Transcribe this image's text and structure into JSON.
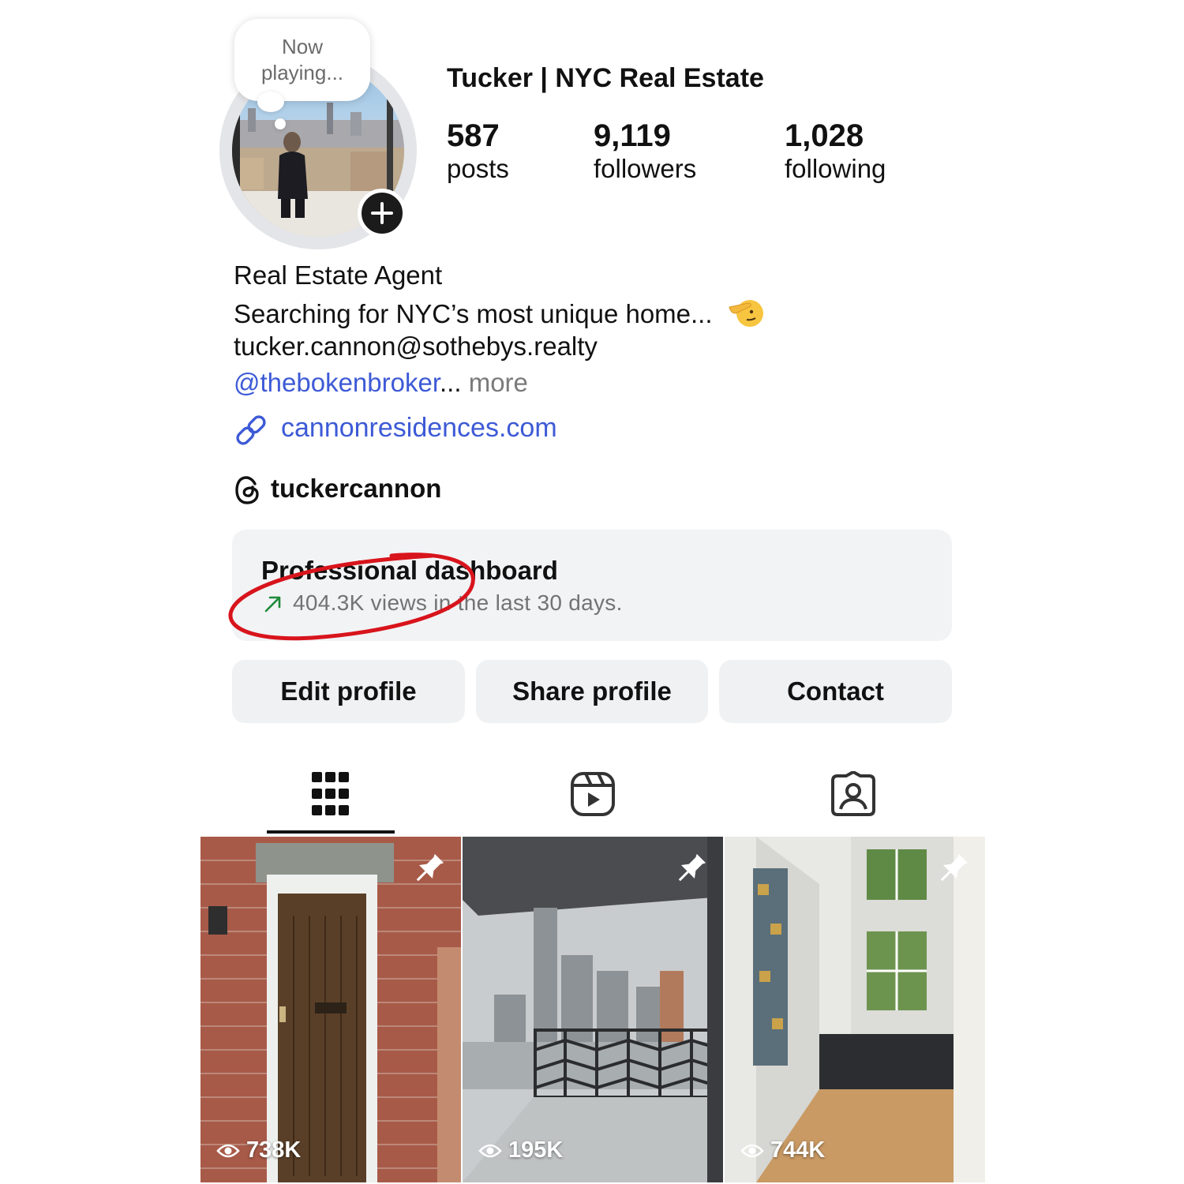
{
  "note": {
    "text": "Now playing..."
  },
  "profile": {
    "username": "Tucker | NYC Real Estate",
    "stats": [
      {
        "value": "587",
        "label": "posts"
      },
      {
        "value": "9,119",
        "label": "followers"
      },
      {
        "value": "1,028",
        "label": "following"
      }
    ]
  },
  "bio": {
    "category": "Real Estate Agent",
    "line1": "Searching for NYC’s most unique home...",
    "emoji_icon": "saluting-face",
    "email": "tucker.cannon@sothebys.realty",
    "mention": "@thebokenbroker",
    "ellipsis": "...",
    "more": " more",
    "link_icon": "link-icon",
    "website": "cannonresidences.com",
    "threads_icon": "threads-icon",
    "threads_handle": "tuckercannon"
  },
  "dashboard": {
    "title": "Professional dashboard",
    "subtitle": "404.3K views in the last 30 days.",
    "trend_icon": "arrow-up-right-icon",
    "trend_color": "#1f8a3b",
    "annotation_color": "#d8141c"
  },
  "buttons": {
    "edit": "Edit profile",
    "share": "Share profile",
    "contact": "Contact"
  },
  "tabs": [
    {
      "icon": "grid-icon",
      "active": true
    },
    {
      "icon": "reels-icon",
      "active": false
    },
    {
      "icon": "tagged-icon",
      "active": false
    }
  ],
  "posts": [
    {
      "views": "738K",
      "pinned": true,
      "subject": "wooden-door-brick-wall"
    },
    {
      "views": "195K",
      "pinned": true,
      "subject": "balcony-skyline-view"
    },
    {
      "views": "744K",
      "pinned": true,
      "subject": "townhouse-interior"
    }
  ]
}
